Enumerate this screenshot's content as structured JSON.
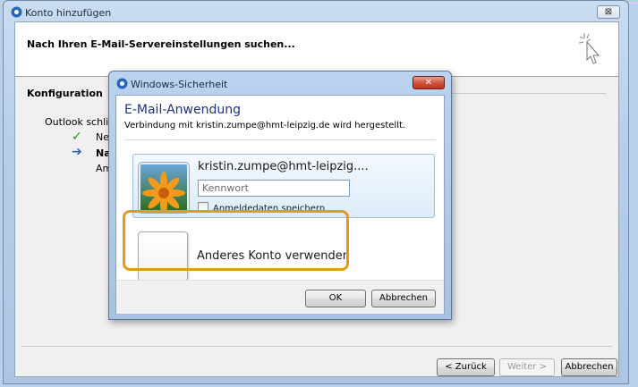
{
  "outer_window": {
    "title": "Konto hinzufügen",
    "close_symbol": "⊠",
    "header_text": "Nach Ihren E-Mail-Servereinstellungen suchen...",
    "section_title": "Konfiguration",
    "description": "Outlook schließt",
    "steps": [
      {
        "icon": "checkmark-icon",
        "symbol": "✓",
        "label": "Net"
      },
      {
        "icon": "arrow-right-icon",
        "symbol": "➔",
        "label": "Nac"
      },
      {
        "icon": "",
        "symbol": "",
        "label": "Am"
      }
    ],
    "buttons": {
      "back": "< Zurück",
      "next": "Weiter >",
      "cancel": "Abbrechen"
    }
  },
  "security_dialog": {
    "title": "Windows-Sicherheit",
    "close_symbol": "✕",
    "heading": "E-Mail-Anwendung",
    "subtitle": "Verbindung mit kristin.zumpe@hmt-leipzig.de wird hergestellt.",
    "account": {
      "username": "kristin.zumpe@hmt-leipzig....",
      "password_placeholder": "Kennwort",
      "remember_label": "Anmeldedaten speichern"
    },
    "other_account_label": "Anderes Konto verwenden",
    "buttons": {
      "ok": "OK",
      "cancel": "Abbrechen"
    }
  },
  "colors": {
    "highlight": "#e59a1a",
    "heading_blue": "#1e3287",
    "close_red": "#c3301a"
  }
}
